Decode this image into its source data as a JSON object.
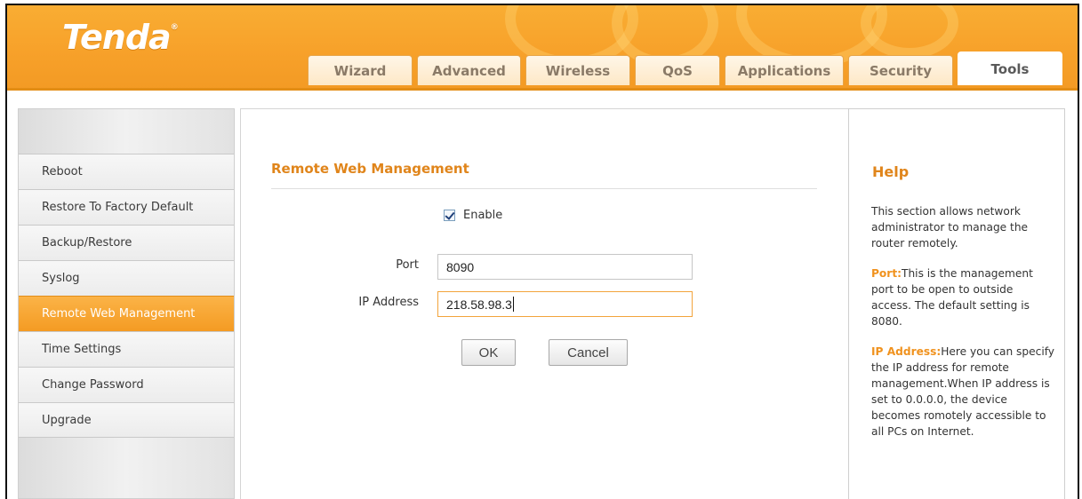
{
  "brand": {
    "logo": "Tenda",
    "logo_mark": "®",
    "accent_color": "#f7a12a",
    "title_color": "#e0851b"
  },
  "tabs": [
    {
      "label": "Wizard",
      "active": false
    },
    {
      "label": "Advanced",
      "active": false
    },
    {
      "label": "Wireless",
      "active": false
    },
    {
      "label": "QoS",
      "active": false
    },
    {
      "label": "Applications",
      "active": false
    },
    {
      "label": "Security",
      "active": false
    },
    {
      "label": "Tools",
      "active": true
    }
  ],
  "sidebar": {
    "items": [
      {
        "label": "Reboot",
        "active": false
      },
      {
        "label": "Restore To Factory Default",
        "active": false
      },
      {
        "label": "Backup/Restore",
        "active": false
      },
      {
        "label": "Syslog",
        "active": false
      },
      {
        "label": "Remote Web Management",
        "active": true
      },
      {
        "label": "Time Settings",
        "active": false
      },
      {
        "label": "Change Password",
        "active": false
      },
      {
        "label": "Upgrade",
        "active": false
      }
    ]
  },
  "main": {
    "title": "Remote Web Management",
    "enable": {
      "label": "Enable",
      "checked": true
    },
    "port": {
      "label": "Port",
      "value": "8090"
    },
    "ip": {
      "label": "IP Address",
      "value": "218.58.98.3"
    },
    "ok_label": "OK",
    "cancel_label": "Cancel"
  },
  "help": {
    "title": "Help",
    "intro": "This section allows network administrator to manage the router remotely.",
    "port_keyword": "Port:",
    "port_text": "This is the management port to be open to outside access. The default setting is 8080.",
    "ip_keyword": "IP Address:",
    "ip_text": "Here you can specify the IP address for remote management.When IP address is set to 0.0.0.0, the device becomes romotely accessible to all PCs on Internet."
  }
}
